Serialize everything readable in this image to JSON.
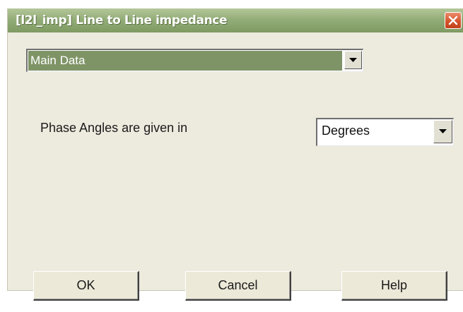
{
  "window": {
    "title": "[l2l_imp] Line to Line impedance"
  },
  "page_selector": {
    "selected": "Main Data"
  },
  "phase_angle": {
    "label": "Phase Angles are given in",
    "selected": "Degrees"
  },
  "buttons": {
    "ok": "OK",
    "cancel": "Cancel",
    "help": "Help"
  },
  "colors": {
    "titlebar": "#93ad78",
    "dialog_background": "#edeade",
    "selection_highlight": "#7f9466",
    "close_button": "#d5542c"
  }
}
